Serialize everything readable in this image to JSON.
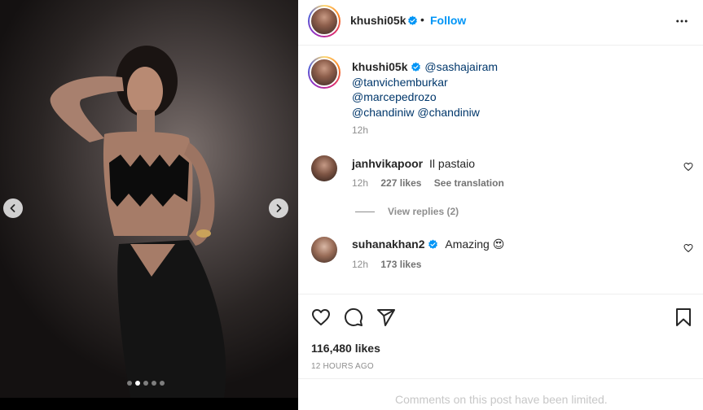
{
  "post": {
    "author": "khushi05k",
    "follow_label": "Follow",
    "separator": "•",
    "caption_mentions": [
      "@sashajairam",
      "@tanvichemburkar",
      "@marcepedrozo",
      "@chandiniw",
      "@chandiniw"
    ],
    "caption_time": "12h",
    "carousel": {
      "slide_count": 5,
      "active_index": 1
    }
  },
  "comments": [
    {
      "username": "janhvikapoor",
      "verified": false,
      "text": "Il pastaio",
      "time": "12h",
      "likes": "227 likes",
      "translate": "See translation",
      "view_replies": "View replies (2)"
    },
    {
      "username": "suhanakhan2",
      "verified": true,
      "text": "Amazing",
      "emoji": "😍",
      "time": "12h",
      "likes": "173 likes"
    }
  ],
  "engagement": {
    "likes": "116,480 likes",
    "date": "12 HOURS AGO",
    "comments_limited": "Comments on this post have been limited."
  },
  "icons": {
    "prev": "chevron-left-icon",
    "next": "chevron-right-icon",
    "more": "more-options-icon",
    "verified": "verified-badge-icon",
    "like": "heart-icon",
    "comment": "comment-icon",
    "share": "share-icon",
    "save": "bookmark-icon"
  },
  "colors": {
    "link_blue": "#0095f6",
    "mention_blue": "#00376b",
    "verified_blue": "#0095f6",
    "muted": "#8e8e8e"
  }
}
